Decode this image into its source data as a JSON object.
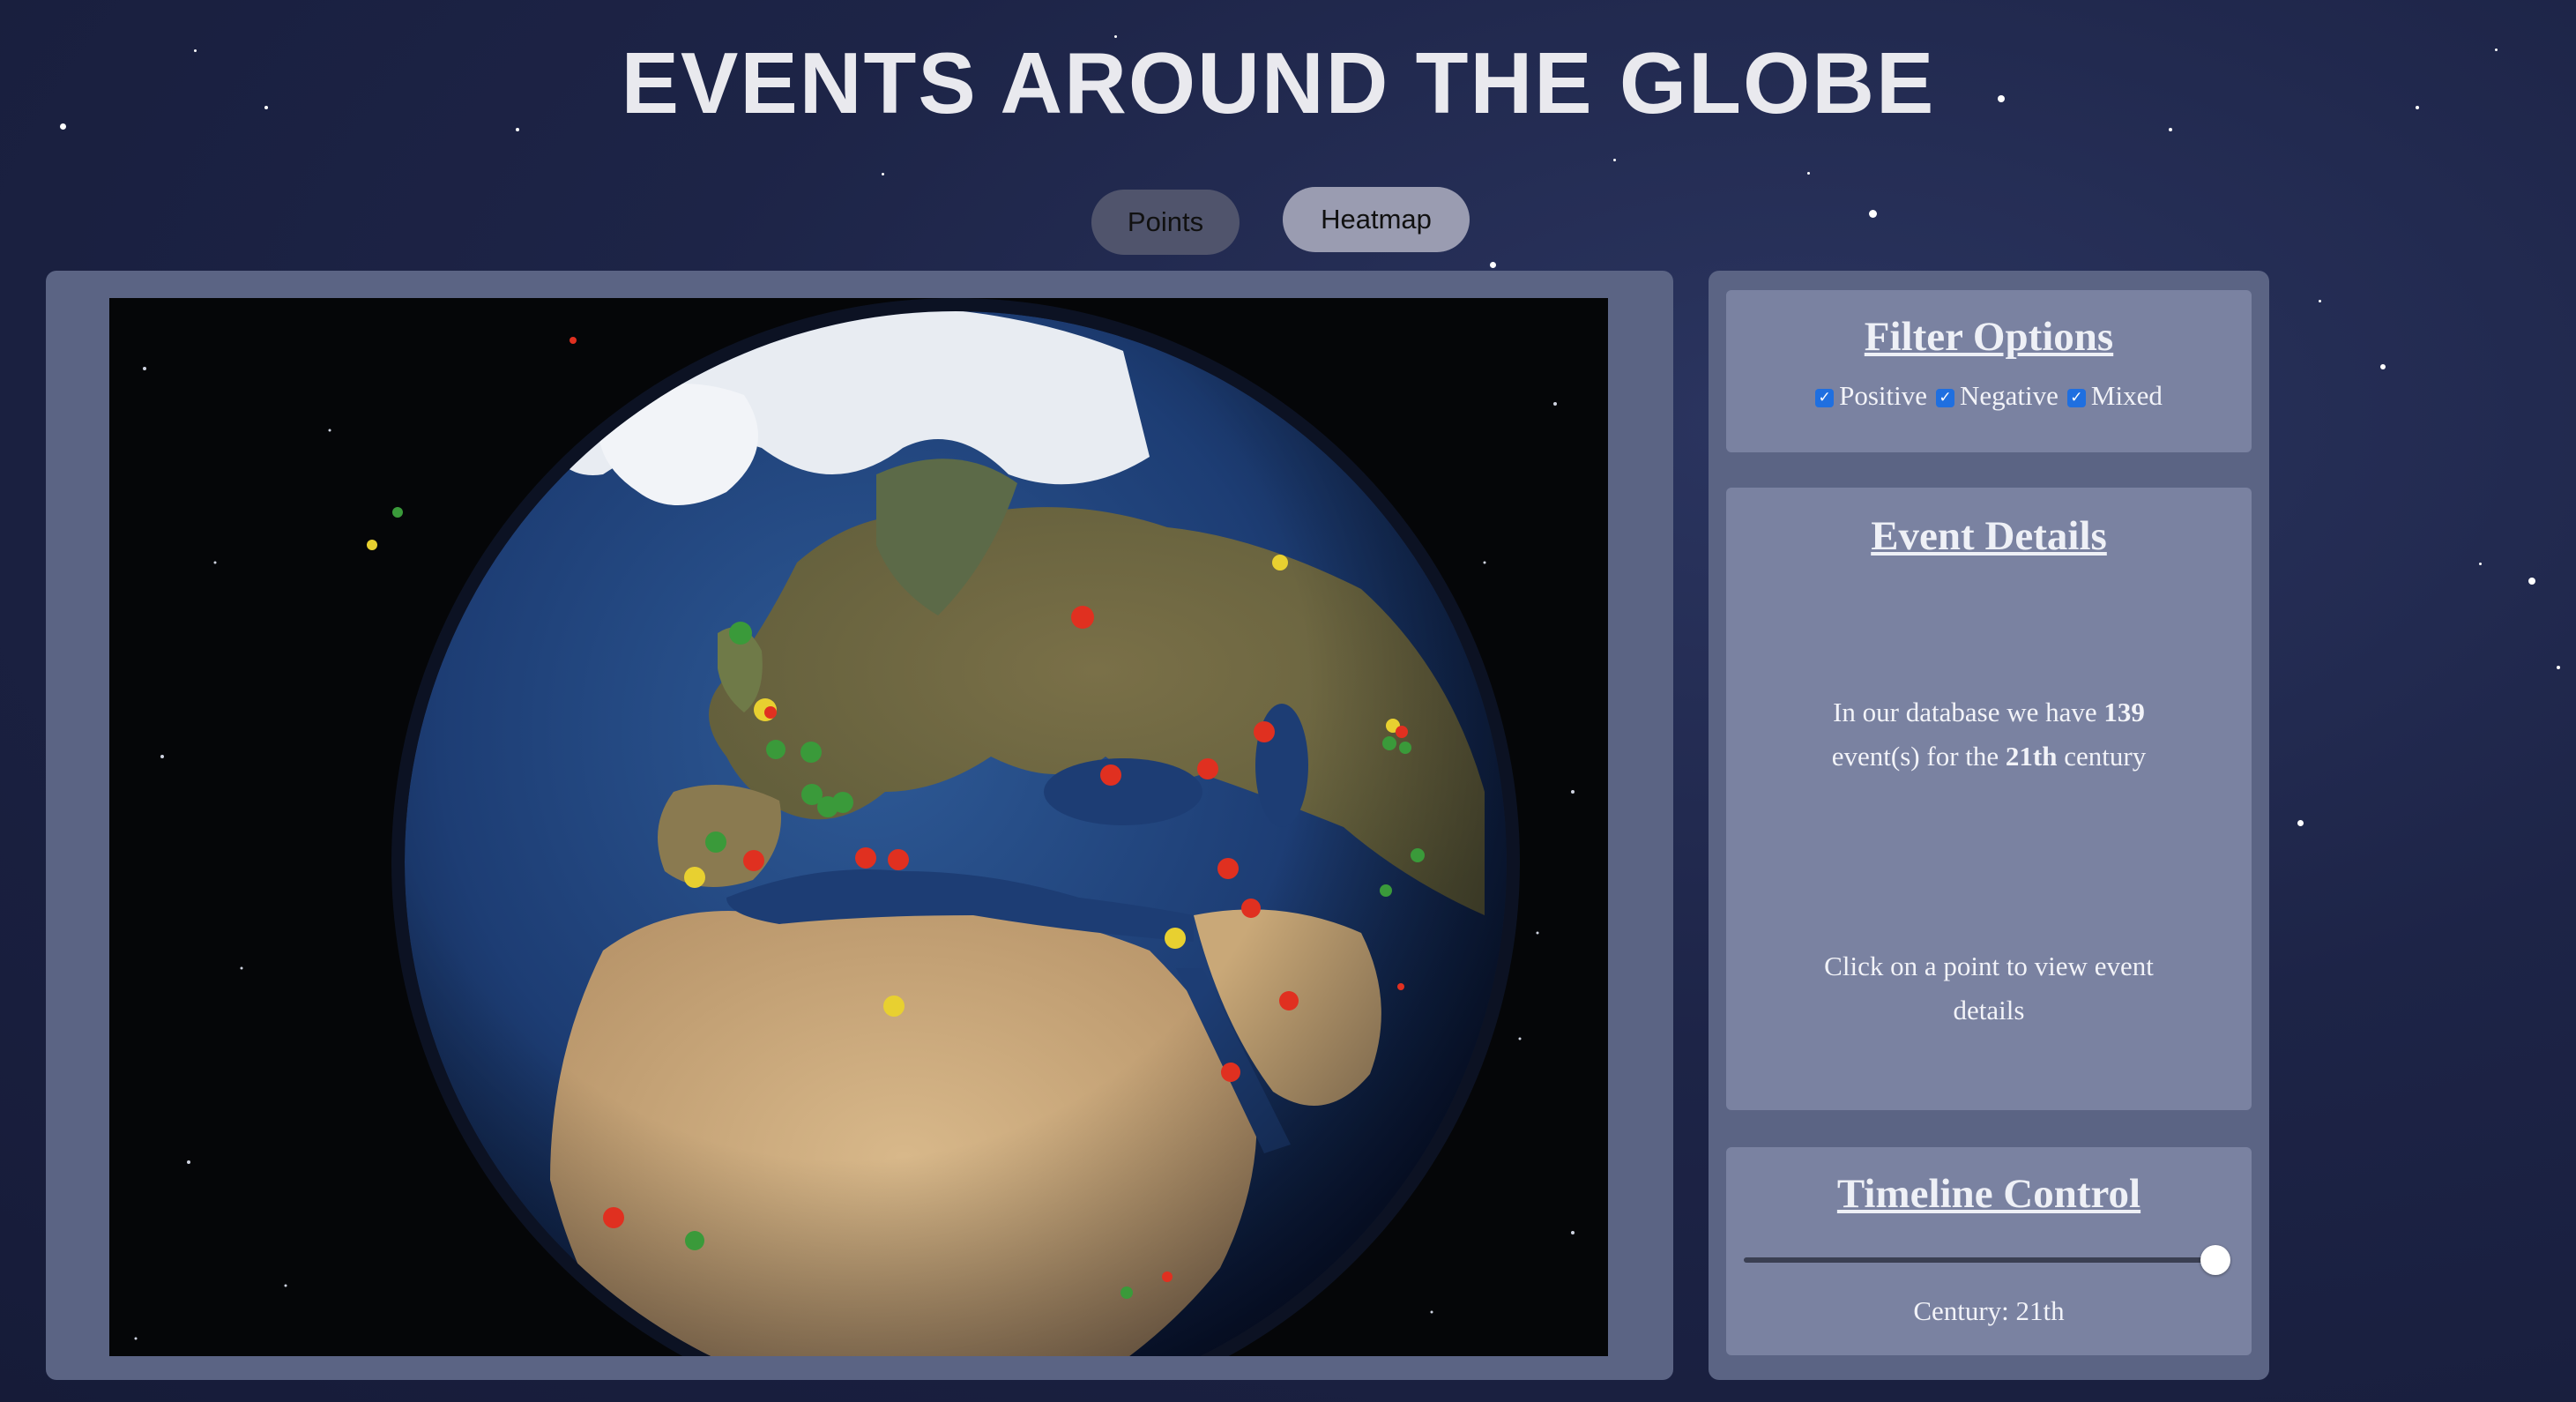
{
  "header": {
    "title": "EVENTS AROUND THE GLOBE"
  },
  "view_toggle": {
    "points_label": "Points",
    "heatmap_label": "Heatmap",
    "active": "Heatmap"
  },
  "filter_options": {
    "title": "Filter Options",
    "options": [
      {
        "label": "Positive",
        "checked": true
      },
      {
        "label": "Negative",
        "checked": true
      },
      {
        "label": "Mixed",
        "checked": true
      }
    ]
  },
  "event_details": {
    "title": "Event Details",
    "summary_prefix": "In our database we have",
    "count": "139",
    "summary_middle": "event(s) for the",
    "century": "21th",
    "summary_suffix": "century",
    "hint": "Click on a point to view event details"
  },
  "timeline": {
    "title": "Timeline Control",
    "label": "Century: 21th"
  },
  "colors": {
    "positive": "#3a9a3a",
    "negative": "#e03020",
    "mixed": "#e8d030",
    "checkbox": "#1f6fe0"
  }
}
